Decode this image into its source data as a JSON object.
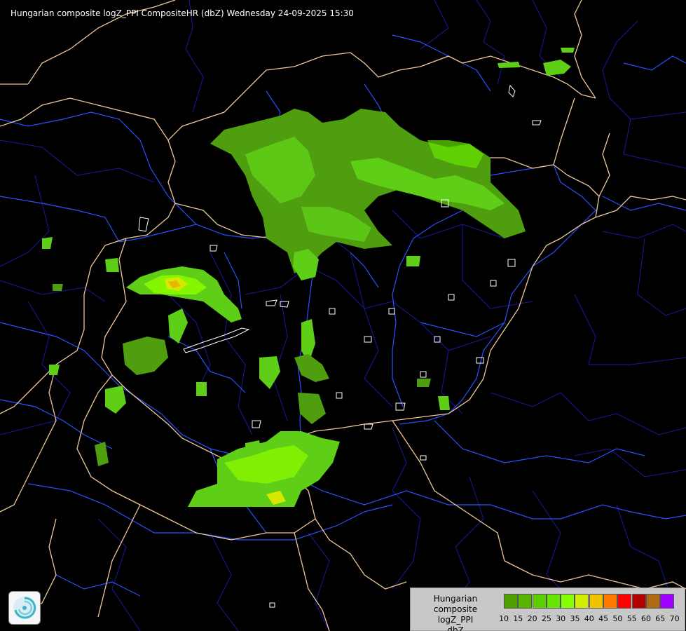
{
  "header": {
    "title": "Hungarian composite logZ_PPI CompositeHR (dbZ) Wednesday 24-09-2025 15:30"
  },
  "legend": {
    "title_lines": [
      "Hungarian composite",
      "logZ_PPI",
      "dbZ"
    ],
    "ticks": [
      "10",
      "15",
      "20",
      "25",
      "30",
      "35",
      "40",
      "45",
      "50",
      "55",
      "60",
      "65",
      "70"
    ],
    "colors": [
      "#4fa000",
      "#5ab400",
      "#5ccf00",
      "#66e600",
      "#84ff00",
      "#d2ee00",
      "#f0c200",
      "#ff7a00",
      "#ff0000",
      "#b40000",
      "#b06a14",
      "#a000ff",
      "#b4b4ff"
    ]
  },
  "map": {
    "colors": {
      "background": "#000000",
      "country_border": "#f0c89a",
      "admin_border": "#1a1aa0",
      "river": "#2a50ff",
      "lake": "#ffffff",
      "echo_weak": "#4f9e10",
      "echo_mid": "#5ecf16",
      "echo_strong": "#86f500",
      "echo_yellow": "#d6e800",
      "echo_orange": "#e6b800"
    },
    "logo_icon": "met-service-logo-icon"
  }
}
